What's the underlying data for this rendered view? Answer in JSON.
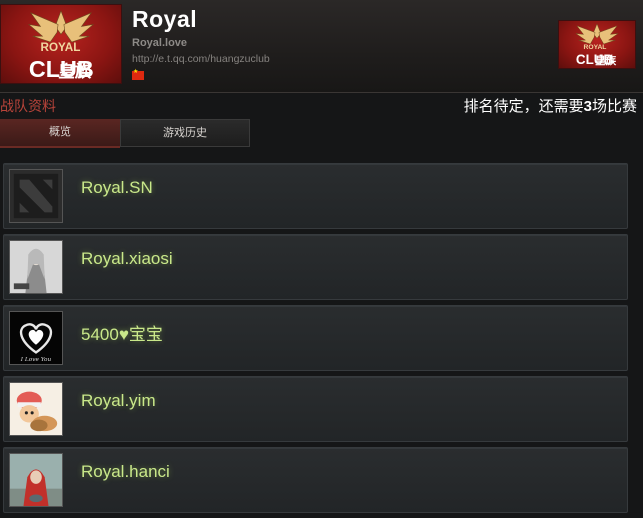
{
  "team": {
    "name": "Royal",
    "tag": "Royal.love",
    "url": "http://e.t.qq.com/huangzuclub",
    "country_flag": "china-flag-icon",
    "logo_text": {
      "top": "ROYAL",
      "bottom_left": "CLUB",
      "bottom_right": "皇族"
    }
  },
  "section": {
    "title": "战队资料",
    "rank_prefix": "排名待定，还需要",
    "rank_count": "3",
    "rank_suffix": "场比赛"
  },
  "tabs": [
    {
      "label": "概览",
      "active": true
    },
    {
      "label": "游戏历史",
      "active": false
    }
  ],
  "players": [
    {
      "name": "Royal.SN",
      "avatar": "dota-logo-avatar"
    },
    {
      "name": "Royal.xiaosi",
      "avatar": "character-portrait-avatar"
    },
    {
      "name": "5400♥宝宝",
      "avatar": "heart-avatar",
      "avatar_caption": "I Love You"
    },
    {
      "name": "Royal.yim",
      "avatar": "chopper-cartoon-avatar"
    },
    {
      "name": "Royal.hanci",
      "avatar": "girl-red-hood-avatar"
    }
  ],
  "colors": {
    "logo_red": "#a11a16",
    "player_name": "#c9e88a",
    "section_title": "#b8443a"
  }
}
